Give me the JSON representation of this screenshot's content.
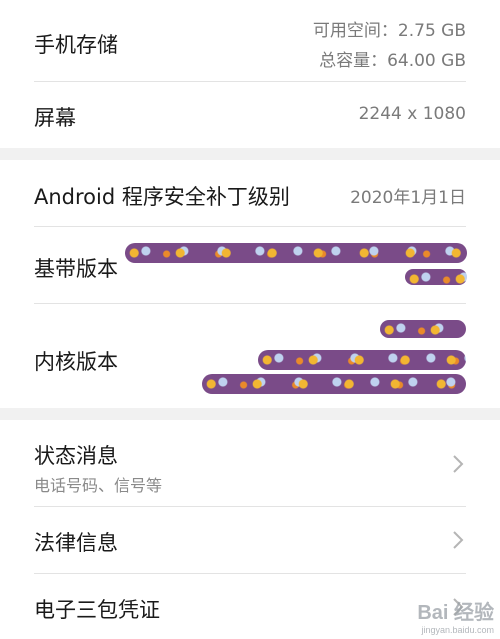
{
  "storage": {
    "title": "手机存储",
    "available": "可用空间：2.75 GB",
    "total": "总容量：64.00 GB"
  },
  "screen": {
    "title": "屏幕",
    "value": "2244 x 1080"
  },
  "security_patch": {
    "title": "Android 程序安全补丁级别",
    "value": "2020年1月1日"
  },
  "baseband": {
    "title": "基带版本"
  },
  "kernel": {
    "title": "内核版本"
  },
  "status": {
    "title": "状态消息",
    "subtitle": "电话号码、信号等"
  },
  "legal": {
    "title": "法律信息"
  },
  "warranty": {
    "title": "电子三包凭证"
  },
  "watermark": {
    "main": "Bai 经验",
    "sub": "jingyan.baidu.com"
  }
}
